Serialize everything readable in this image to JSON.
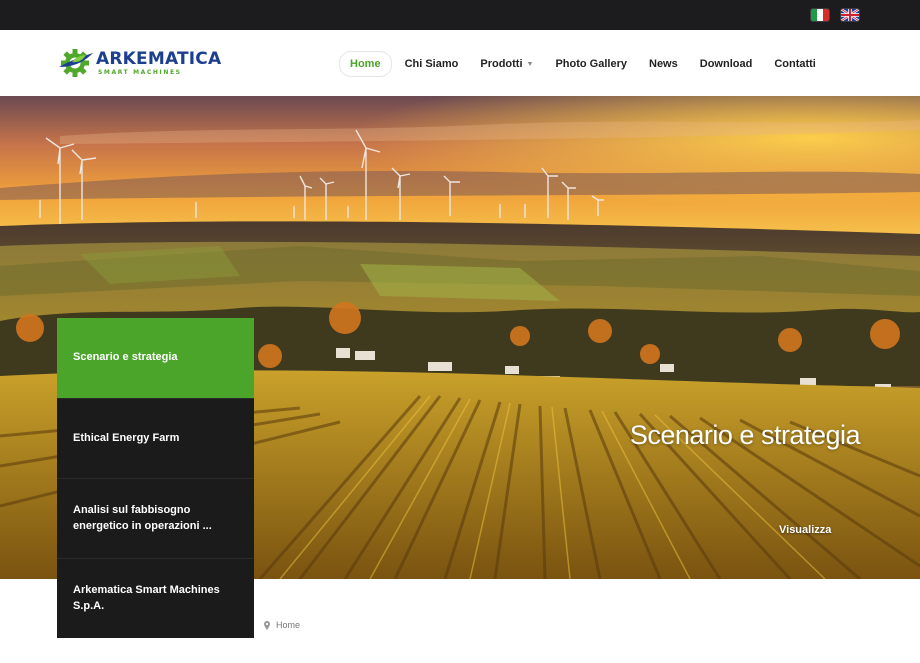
{
  "languages": [
    {
      "name": "italian-flag-icon",
      "colors": [
        "#1f9a48",
        "#ffffff",
        "#d62c2c"
      ]
    },
    {
      "name": "uk-flag-icon",
      "colors": [
        "#1c3f94",
        "#ffffff",
        "#cc2233"
      ]
    }
  ],
  "brand": {
    "name": "ARKEMATICA",
    "tagline": "SMART MACHINES",
    "primary_color": "#1d3f8f",
    "accent_color": "#4fa82b"
  },
  "nav": {
    "items": [
      {
        "label": "Home",
        "active": true
      },
      {
        "label": "Chi Siamo"
      },
      {
        "label": "Prodotti",
        "has_dropdown": true
      },
      {
        "label": "Photo Gallery"
      },
      {
        "label": "News"
      },
      {
        "label": "Download"
      },
      {
        "label": "Contatti"
      }
    ]
  },
  "hero": {
    "title": "Scenario e strategia",
    "link_label": "Visualizza"
  },
  "slides": [
    {
      "label": "Scenario e strategia",
      "active": true
    },
    {
      "label": "Ethical Energy Farm"
    },
    {
      "label": "Analisi sul fabbisogno energetico in operazioni ..."
    },
    {
      "label": "Arkematica Smart Machines S.p.A."
    }
  ],
  "breadcrumb": {
    "icon": "map-pin-icon",
    "label": "Home"
  }
}
